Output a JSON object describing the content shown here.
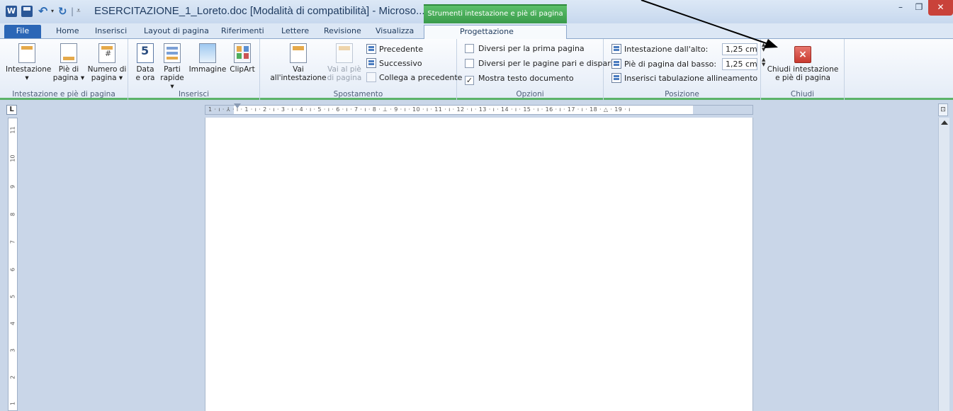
{
  "window": {
    "title": "ESERCITAZIONE_1_Loreto.doc [Modalità di compatibilità]  -  Microso...",
    "contextual_tab_group": "Strumenti intestazione e piè di pagina",
    "app_icon": "W",
    "minimize": "–",
    "maximize": "❐",
    "close": "✕"
  },
  "quick_access": {
    "save_icon": "save-icon",
    "undo_icon": "undo-icon",
    "redo_icon": "redo-icon"
  },
  "tabs": [
    {
      "label": "File"
    },
    {
      "label": "Home"
    },
    {
      "label": "Inserisci"
    },
    {
      "label": "Layout di pagina"
    },
    {
      "label": "Riferimenti"
    },
    {
      "label": "Lettere"
    },
    {
      "label": "Revisione"
    },
    {
      "label": "Visualizza"
    },
    {
      "label": "Progettazione"
    }
  ],
  "ribbon": {
    "group_header_footer": {
      "label": "Intestazione e piè di pagina",
      "intestazione": "Intestazione",
      "pie_di_pagina_1": "Piè di",
      "pie_di_pagina_2": "pagina",
      "numero_di_pagina_1": "Numero di",
      "numero_di_pagina_2": "pagina"
    },
    "group_insert": {
      "label": "Inserisci",
      "data_1": "Data",
      "data_2": "e ora",
      "parti_1": "Parti",
      "parti_2": "rapide",
      "immagine": "Immagine",
      "clipart": "ClipArt"
    },
    "group_navigation": {
      "label": "Spostamento",
      "vai_intestazione_1": "Vai",
      "vai_intestazione_2": "all'intestazione",
      "vai_pie_1": "Vai al piè",
      "vai_pie_2": "di pagina",
      "precedente": "Precedente",
      "successivo": "Successivo",
      "collega": "Collega a precedente"
    },
    "group_options": {
      "label": "Opzioni",
      "diversi_prima": "Diversi per la prima pagina",
      "diversi_pari_dispari": "Diversi per le pagine pari e dispari",
      "mostra_testo": "Mostra testo documento",
      "checked_mark": "✓"
    },
    "group_position": {
      "label": "Posizione",
      "intestazione_alto": "Intestazione dall'alto:",
      "intestazione_alto_value": "1,25 cm",
      "pie_basso": "Piè di pagina dal basso:",
      "pie_basso_value": "1,25 cm",
      "tabulazione": "Inserisci tabulazione allineamento"
    },
    "group_close": {
      "label": "Chiudi",
      "chiudi_1": "Chiudi intestazione",
      "chiudi_2": "e piè di pagina"
    }
  },
  "ruler": {
    "corner": "L",
    "toggle": "⊡",
    "h_ticks": "1 · ı · ⅄ · ı · 1 · ı · 2 · ı · 3 · ı · 4 · ı · 5 · ı · 6 · ı · 7 · ı · 8 · ⊥ · 9 · ı · 10 · ı · 11 · ı · 12 · ı · 13 · ı · 14 · ı · 15 · ı · 16 · ı · 17 · ı · 18 · △ · 19 · ı",
    "v_ticks": [
      "11",
      "10",
      "9",
      "8",
      "7",
      "6",
      "5",
      "4",
      "3",
      "2",
      "1"
    ]
  }
}
